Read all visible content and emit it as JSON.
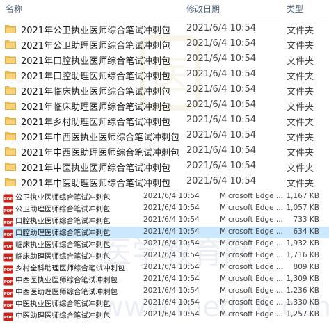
{
  "header": {
    "name": "名称",
    "modified": "修改日期",
    "type": "类型"
  },
  "folders": [
    {
      "name": "2021年公卫执业医师综合笔试冲刺包",
      "date": "2021/6/4 10:54",
      "type": "文件夹"
    },
    {
      "name": "2021年公卫助理医师综合笔试冲刺包",
      "date": "2021/6/4 10:54",
      "type": "文件夹"
    },
    {
      "name": "2021年口腔执业医师综合笔试冲刺包",
      "date": "2021/6/4 10:54",
      "type": "文件夹"
    },
    {
      "name": "2021年口腔助理医师综合笔试冲刺包",
      "date": "2021/6/4 10:54",
      "type": "文件夹"
    },
    {
      "name": "2021年临床执业医师综合笔试冲刺包",
      "date": "2021/6/4 10:54",
      "type": "文件夹"
    },
    {
      "name": "2021年临床助理医师综合笔试冲刺包",
      "date": "2021/6/4 10:54",
      "type": "文件夹"
    },
    {
      "name": "2021年乡村助理医师综合笔试冲刺包",
      "date": "2021/6/4 10:54",
      "type": "文件夹"
    },
    {
      "name": "2021年中西医执业医师综合笔试冲刺包",
      "date": "2021/6/4 10:54",
      "type": "文件夹"
    },
    {
      "name": "2021年中西医助理医师综合笔试冲刺包",
      "date": "2021/6/4 10:54",
      "type": "文件夹"
    },
    {
      "name": "2021年中医执业医师综合笔试冲刺包",
      "date": "2021/6/4 10:54",
      "type": "文件夹"
    },
    {
      "name": "2021年中医助理医师综合笔试冲刺包",
      "date": "2021/6/4 10:54",
      "type": "文件夹"
    }
  ],
  "pdfs": [
    {
      "name": "公卫执业医师综合笔试冲刺包",
      "date": "2021/6/4 10:54",
      "type": "Microsoft Edge ...",
      "size": "1,167 KB"
    },
    {
      "name": "公卫助理医师综合笔试冲刺包",
      "date": "2021/6/4 10:54",
      "type": "Microsoft Edge ...",
      "size": "1,057 KB"
    },
    {
      "name": "口腔执业医师综合笔试冲刺包",
      "date": "2021/6/4 10:54",
      "type": "Microsoft Edge ...",
      "size": "733 KB"
    },
    {
      "name": "口腔助理医师综合笔试冲刺包",
      "date": "2021/6/4 10:54",
      "type": "Microsoft Edge ...",
      "size": "634 KB"
    },
    {
      "name": "临床执业医师综合笔试冲刺包",
      "date": "2021/6/4 10:54",
      "type": "Microsoft Edge ...",
      "size": "1,932 KB"
    },
    {
      "name": "临床助理医师综合笔试冲刺包",
      "date": "2021/6/4 10:54",
      "type": "Microsoft Edge ...",
      "size": "1,716 KB"
    },
    {
      "name": "乡村全科助理医师综合笔试冲刺包",
      "date": "2021/6/4 10:54",
      "type": "Microsoft Edge ...",
      "size": "809 KB"
    },
    {
      "name": "中西医执业医师综合笔试冲刺包",
      "date": "2021/6/4 10:54",
      "type": "Microsoft Edge ...",
      "size": "1,309 KB"
    },
    {
      "name": "中西医助理医师综合笔试冲刺包",
      "date": "2021/6/4 10:54",
      "type": "Microsoft Edge ...",
      "size": "1,236 KB"
    },
    {
      "name": "中医执业医师综合笔试冲刺包",
      "date": "2021/6/4 10:54",
      "type": "Microsoft Edge ...",
      "size": "1,330 KB"
    },
    {
      "name": "中医助理医师综合笔试冲刺包",
      "date": "2021/6/4 10:54",
      "type": "Microsoft Edge ...",
      "size": "1,257 KB"
    }
  ],
  "selected_pdf": 3,
  "icons": {
    "folder": "folder-icon",
    "pdf": "pdf-file-icon"
  },
  "colors": {
    "folder": "#f2c55c",
    "pdf": "#c8261c",
    "selection": "#cce8ff",
    "header_text": "#4c607a"
  },
  "watermark": {
    "brand": "医",
    "url": "www.med66.com",
    "banner": "医学教育网"
  }
}
